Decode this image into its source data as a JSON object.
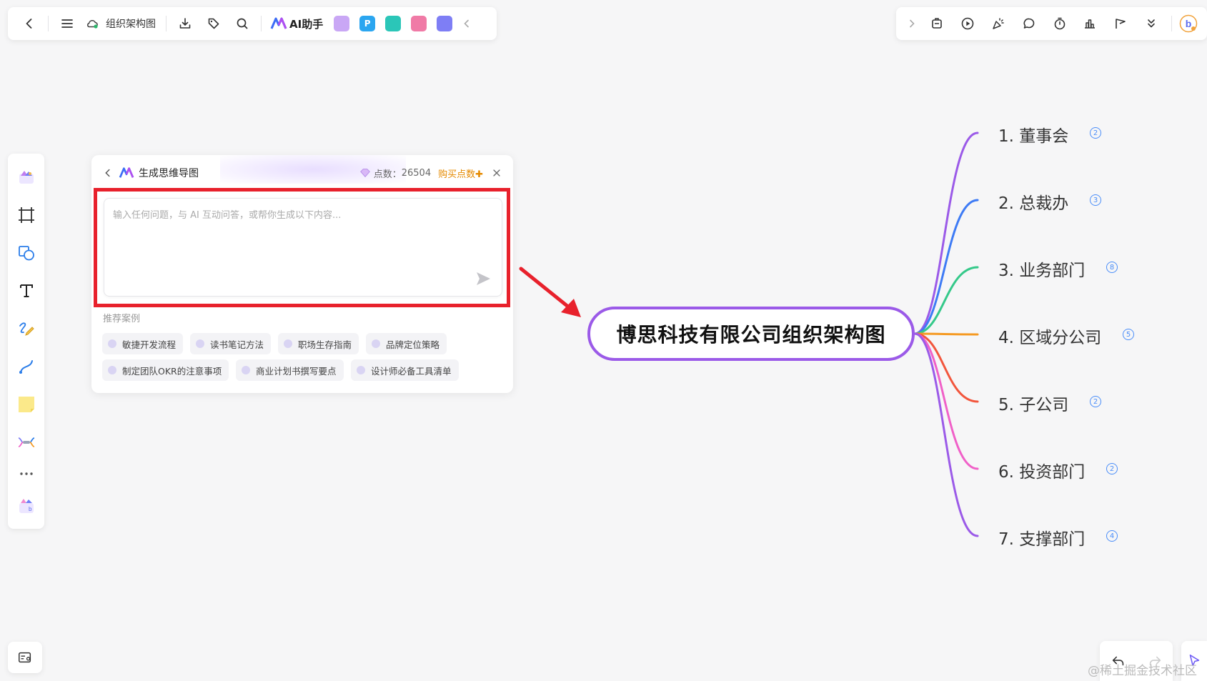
{
  "topbar": {
    "doc_title": "组织架构图",
    "ai_label": "AI助手",
    "mini_apps": [
      {
        "name": "image-app-icon",
        "color": "#c9a7f5",
        "glyph": ""
      },
      {
        "name": "p-app-icon",
        "color": "#2ba6f0",
        "glyph": "P"
      },
      {
        "name": "mindmap-app-icon",
        "color": "#2bc6b8",
        "glyph": ""
      },
      {
        "name": "flow-app-icon",
        "color": "#f07aa6",
        "glyph": ""
      },
      {
        "name": "chat-app-icon",
        "color": "#7e7ef5",
        "glyph": ""
      }
    ]
  },
  "panel": {
    "title": "生成思维导图",
    "points_label": "点数：",
    "points_value": "26504",
    "buy_label": "购买点数✚",
    "input_placeholder": "输入任何问题，与 AI 互动问答，或帮你生成以下内容...",
    "recommend_label": "推荐案例",
    "chips": [
      "敏捷开发流程",
      "读书笔记方法",
      "职场生存指南",
      "品牌定位策略",
      "制定团队OKR的注意事项",
      "商业计划书撰写要点",
      "设计师必备工具清单"
    ]
  },
  "mindmap": {
    "central": "博思科技有限公司组织架构图",
    "branches": [
      {
        "label": "1. 董事会",
        "count": "2",
        "color": "#9b5ae8"
      },
      {
        "label": "2. 总裁办",
        "count": "3",
        "color": "#3e7bf5"
      },
      {
        "label": "3. 业务部门",
        "count": "8",
        "color": "#35c98a"
      },
      {
        "label": "4. 区域分公司",
        "count": "5",
        "color": "#f59a23"
      },
      {
        "label": "5. 子公司",
        "count": "2",
        "color": "#f2563d"
      },
      {
        "label": "6. 投资部门",
        "count": "2",
        "color": "#f060c8"
      },
      {
        "label": "7. 支撑部门",
        "count": "4",
        "color": "#9b5ae8"
      }
    ]
  },
  "watermark": "@稀土掘金技术社区"
}
